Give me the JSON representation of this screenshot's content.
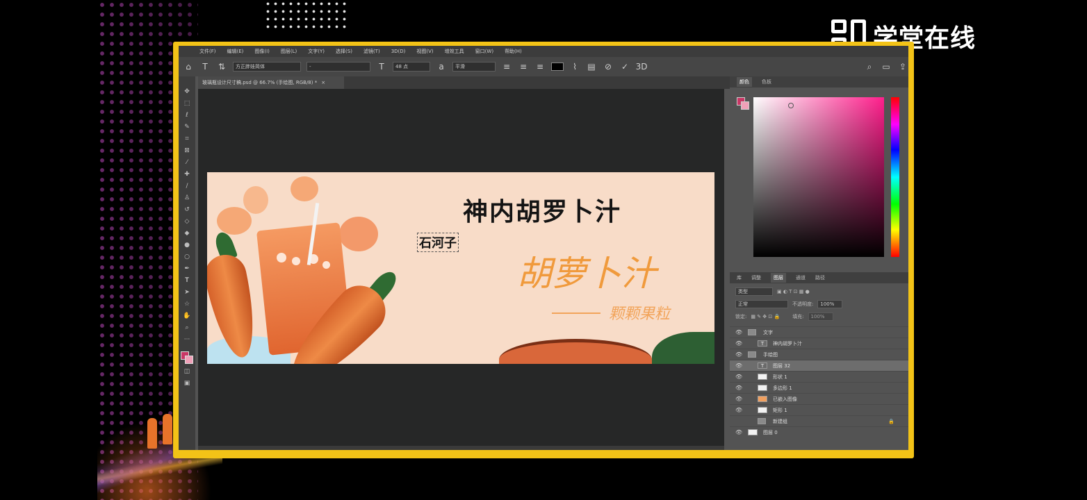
{
  "watermark": {
    "brand": "学堂在线"
  },
  "photoshop": {
    "menu": [
      "文件(F)",
      "编辑(E)",
      "图像(I)",
      "图层(L)",
      "文字(Y)",
      "选择(S)",
      "滤镜(T)",
      "3D(D)",
      "视图(V)",
      "增效工具",
      "窗口(W)",
      "帮助(H)"
    ],
    "options": {
      "font_family": "方正胖娃简体",
      "font_style": "-",
      "font_size": "48 点",
      "antialias": "平滑"
    },
    "document_tab": "玻璃瓶设计尺寸稿.psd @ 66.7% (手绘图, RGB/8) *",
    "canvas": {
      "title": "神内胡罗卜汁",
      "subtitle": "石河子",
      "script_title": "胡萝卜汁",
      "slogan": "颗颗果粒"
    },
    "color_panel": {
      "tabs": [
        "颜色",
        "色板"
      ],
      "fg_color": "#c93665",
      "bg_color": "#f0a0b8"
    },
    "layers_panel": {
      "tabs": [
        "库",
        "调整",
        "图层",
        "通道",
        "路径"
      ],
      "active_tab": "图层",
      "filter_placeholder": "类型",
      "blend_mode": "正常",
      "opacity_label": "不透明度:",
      "opacity": "100%",
      "lock_label": "锁定:",
      "fill_label": "填充:",
      "fill": "100%",
      "layers": [
        {
          "name": "文字",
          "kind": "group",
          "indent": 0
        },
        {
          "name": "神内胡罗卜汁",
          "kind": "text",
          "indent": 1
        },
        {
          "name": "手绘图",
          "kind": "group",
          "indent": 0
        },
        {
          "name": "图层 32",
          "kind": "text",
          "indent": 1,
          "selected": true
        },
        {
          "name": "形状 1",
          "kind": "shape",
          "indent": 1
        },
        {
          "name": "多边形 1",
          "kind": "shape",
          "indent": 1
        },
        {
          "name": "已嵌入图像",
          "kind": "image",
          "indent": 1
        },
        {
          "name": "矩形 1",
          "kind": "shape",
          "indent": 1
        },
        {
          "name": "新建组",
          "kind": "group",
          "indent": 1,
          "locked": true
        },
        {
          "name": "图层 0",
          "kind": "pixel",
          "indent": 0
        }
      ]
    }
  }
}
